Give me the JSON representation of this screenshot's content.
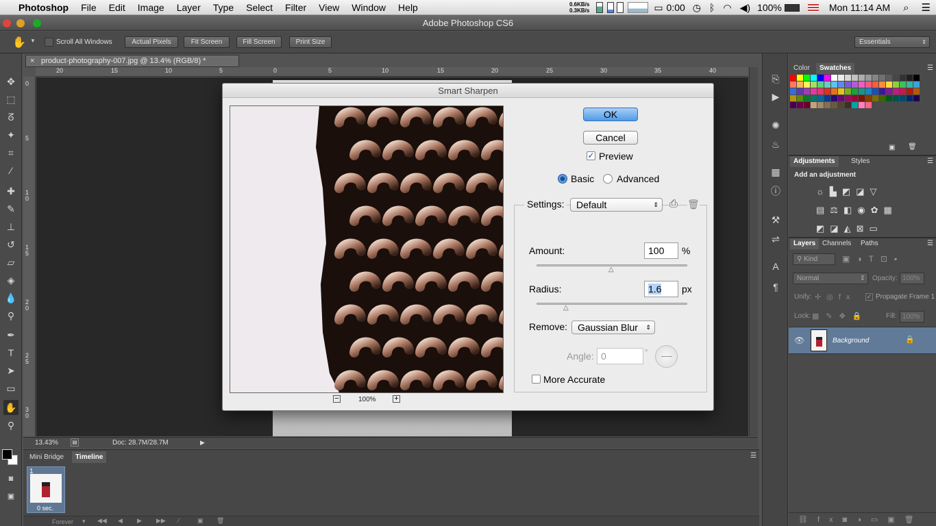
{
  "menubar": {
    "app": "Photoshop",
    "items": [
      "File",
      "Edit",
      "Image",
      "Layer",
      "Type",
      "Select",
      "Filter",
      "View",
      "Window",
      "Help"
    ],
    "net_down": "0.6KB/s",
    "net_up": "0.3KB/s",
    "timer": "0:00",
    "battery": "100%",
    "clock": "Mon 11:14 AM"
  },
  "window": {
    "title": "Adobe Photoshop CS6"
  },
  "options_bar": {
    "scroll_all_windows": "Scroll All Windows",
    "actual_pixels": "Actual Pixels",
    "fit_screen": "Fit Screen",
    "fill_screen": "Fill Screen",
    "print_size": "Print Size",
    "workspace": "Essentials"
  },
  "document": {
    "tab_title": "product-photography-007.jpg @ 13.4% (RGB/8) *",
    "ruler_top": [
      "20",
      "15",
      "10",
      "5",
      "0",
      "5",
      "10",
      "15",
      "20",
      "25",
      "30",
      "35",
      "40"
    ],
    "ruler_left": [
      "0",
      "5",
      "10",
      "15",
      "20",
      "25",
      "30"
    ],
    "zoom": "13.43%",
    "doc_size": "Doc: 28.7M/28.7M"
  },
  "bottom_panel": {
    "tabs": [
      "Mini Bridge",
      "Timeline"
    ],
    "frame_number": "1",
    "frame_delay": "0 sec.",
    "loop": "Forever"
  },
  "color_panel": {
    "tabs": [
      "Color",
      "Swatches"
    ],
    "swatch_colors": [
      "#ff0000",
      "#ffff00",
      "#00ff00",
      "#00ffff",
      "#0000ff",
      "#ff00ff",
      "#ffffff",
      "#ebebeb",
      "#d6d6d6",
      "#c2c2c2",
      "#adadad",
      "#999999",
      "#858585",
      "#707070",
      "#5c5c5c",
      "#474747",
      "#333333",
      "#1f1f1f",
      "#000000",
      "#ff7a5c",
      "#ffb35c",
      "#fff25c",
      "#a3e05c",
      "#5cd17a",
      "#5cd1c2",
      "#5cc2f0",
      "#5c8af0",
      "#7a5cd1",
      "#b35cd1",
      "#f05cc2",
      "#f05c8a",
      "#ff5c3a",
      "#ff8c3a",
      "#ffd93a",
      "#8cd13a",
      "#3ac25c",
      "#3ab3a3",
      "#3aa3e0",
      "#3a6ae0",
      "#5c3ab3",
      "#a33ab3",
      "#e03aa3",
      "#e03a6a",
      "#e62e1a",
      "#e6731a",
      "#e6c21a",
      "#73b31a",
      "#1aa33a",
      "#1a9485",
      "#1a85c2",
      "#1a4fc2",
      "#3a1a94",
      "#851a94",
      "#c21a85",
      "#c21a4f",
      "#b31a0a",
      "#b35a0a",
      "#b3960a",
      "#5a8a0a",
      "#0a7a2a",
      "#0a7366",
      "#0a6696",
      "#0a3a96",
      "#2a0a73",
      "#660a73",
      "#960a66",
      "#960a3a",
      "#801200",
      "#804000",
      "#806b00",
      "#406300",
      "#005a1e",
      "#00524a",
      "#004a6b",
      "#00296b",
      "#1e0052",
      "#4a0052",
      "#6b004a",
      "#6b0029",
      "#c2a37a",
      "#a38a66",
      "#857052",
      "#6b5a42",
      "#524533",
      "#3a3124",
      "#00a3a3",
      "#ff80c0",
      "#ff6680"
    ]
  },
  "adjustments_panel": {
    "tabs": [
      "Adjustments",
      "Styles"
    ],
    "heading": "Add an adjustment"
  },
  "layers_panel": {
    "tabs": [
      "Layers",
      "Channels",
      "Paths"
    ],
    "filter_kind": "Kind",
    "blend_mode": "Normal",
    "opacity_label": "Opacity:",
    "opacity_value": "100%",
    "unify_label": "Unify:",
    "propagate": "Propagate Frame 1",
    "lock_label": "Lock:",
    "fill_label": "Fill:",
    "fill_value": "100%",
    "layer_name": "Background"
  },
  "dialog": {
    "title": "Smart Sharpen",
    "ok": "OK",
    "cancel": "Cancel",
    "preview_label": "Preview",
    "preview_checked": true,
    "mode_basic": "Basic",
    "mode_advanced": "Advanced",
    "selected_mode": "Basic",
    "zoom": "100%",
    "settings_label": "Settings:",
    "settings_value": "Default",
    "amount_label": "Amount:",
    "amount_value": "100",
    "amount_unit": "%",
    "amount_fraction": 0.5,
    "radius_label": "Radius:",
    "radius_value": "1.6",
    "radius_unit": "px",
    "radius_fraction": 0.2,
    "remove_label": "Remove:",
    "remove_value": "Gaussian Blur",
    "angle_label": "Angle:",
    "angle_value": "0",
    "angle_unit": "°",
    "more_accurate": "More Accurate"
  }
}
